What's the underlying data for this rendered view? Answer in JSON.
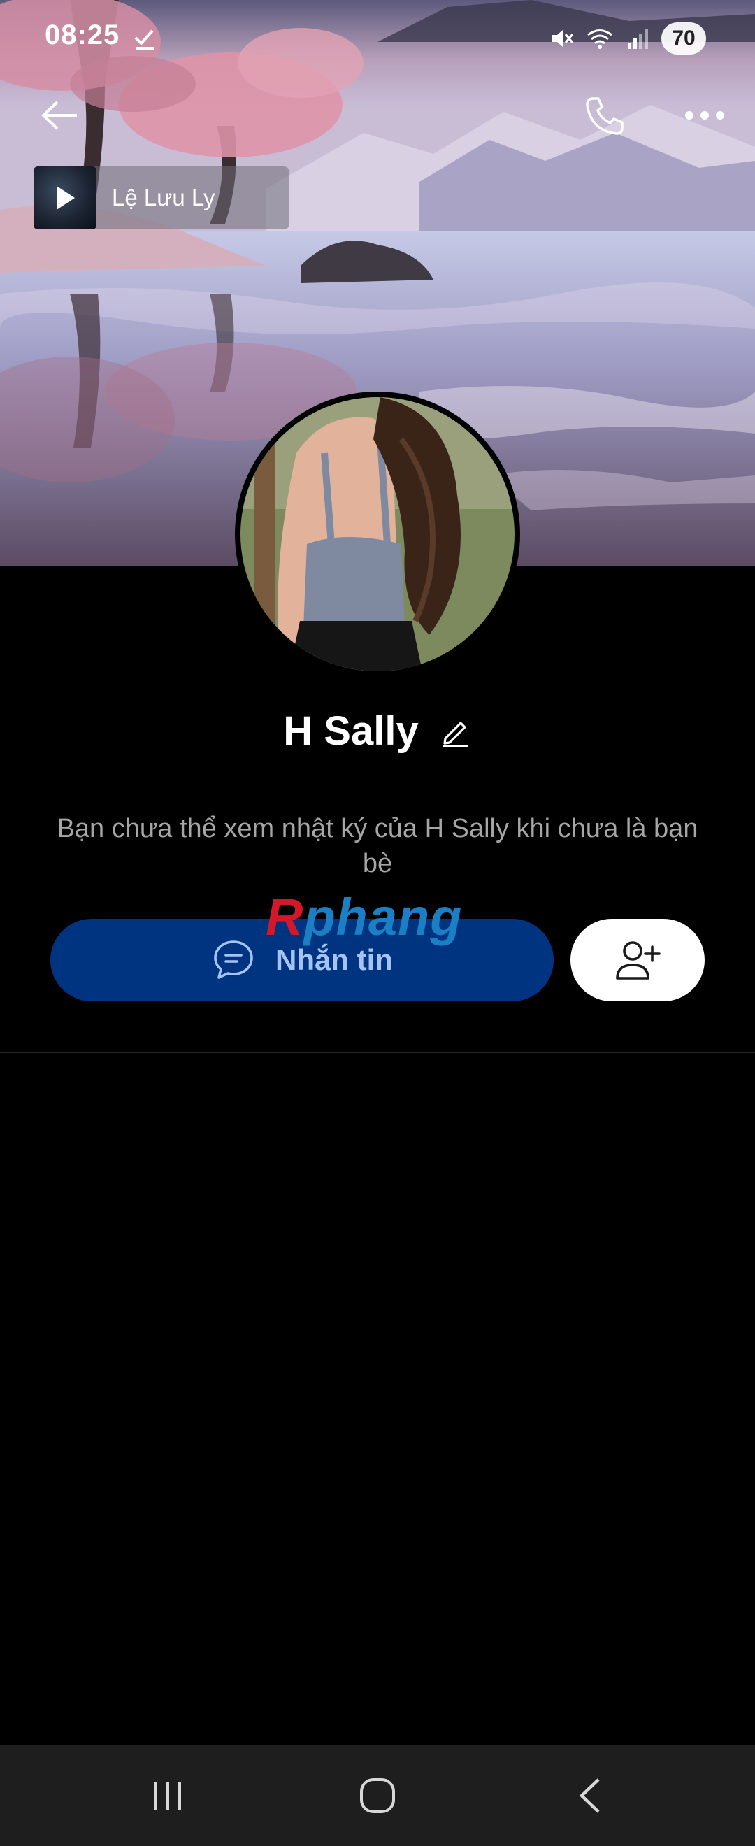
{
  "status_bar": {
    "time": "08:25",
    "battery": "70",
    "icons": [
      "check-done-icon",
      "mute-icon",
      "wifi-icon",
      "signal-icon"
    ]
  },
  "top_bar": {
    "icons": [
      "back-arrow-icon",
      "phone-icon",
      "more-dots-icon"
    ]
  },
  "music": {
    "title": "Lệ Lưu Ly",
    "icon": "play-icon"
  },
  "profile": {
    "name": "H Sally",
    "edit_icon": "pencil-icon",
    "note": "Bạn chưa thể xem nhật ký của H Sally khi chưa là bạn bè"
  },
  "actions": {
    "message_label": "Nhắn tin",
    "message_icon": "chat-bubble-icon",
    "add_friend_icon": "add-user-icon"
  },
  "watermark": {
    "first": "R",
    "rest": "phang"
  },
  "nav_bar": {
    "icons": [
      "recent-apps-icon",
      "home-icon",
      "back-icon"
    ]
  },
  "colors": {
    "background": "#000000",
    "message_button": "#003481",
    "message_text": "#a6c3f5",
    "note_text": "#a6a6a6",
    "nav_bar": "#1e1e1e"
  }
}
